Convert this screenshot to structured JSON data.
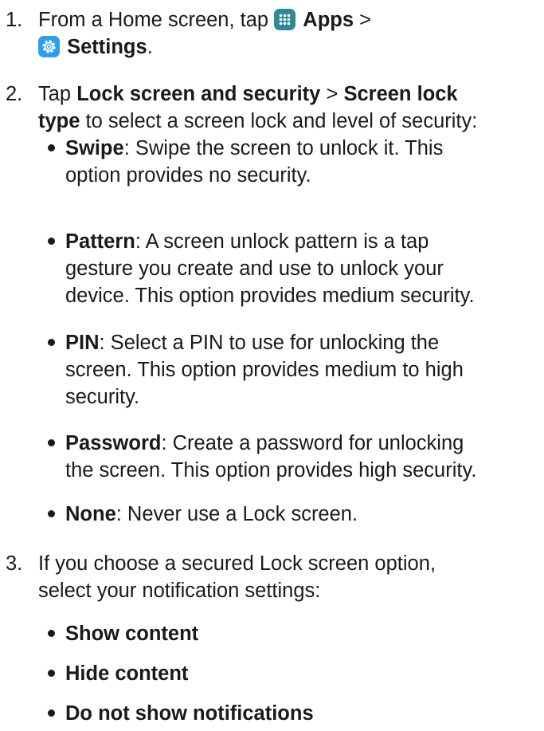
{
  "step1": {
    "number": "1.",
    "text_a": "From a Home screen, tap",
    "apps": "Apps",
    "sep": ">",
    "settings": "Settings",
    "period": ".",
    "apps_icon": "apps-grid-icon",
    "settings_icon": "gear-icon",
    "colors": {
      "apps_icon_bg": "#2d8a96",
      "settings_icon_bg": "#2f9ee6"
    }
  },
  "step2": {
    "number": "2.",
    "tap": "Tap",
    "lock_screen": "Lock screen and security",
    "sep": ">",
    "screen_lock": "Screen lock",
    "type": "type",
    "rest": "to select a screen lock and level of security:",
    "options": [
      {
        "name": "Swipe",
        "desc_1": ": Swipe the screen to unlock it. This",
        "desc_2": "option provides no security."
      },
      {
        "name": "Pattern",
        "desc_1": ": A screen unlock pattern is a tap",
        "desc_2": "gesture you create and use to unlock your",
        "desc_3": "device. This option provides medium security."
      },
      {
        "name": "PIN",
        "desc_1": ": Select a PIN to use for unlocking the",
        "desc_2": "screen. This option provides medium to high",
        "desc_3": "security."
      },
      {
        "name": "Password",
        "desc_1": ": Create a password for unlocking",
        "desc_2": "the screen. This option provides high security."
      },
      {
        "name": "None",
        "desc_1": ": Never use a Lock screen."
      }
    ]
  },
  "step3": {
    "number": "3.",
    "line_1": "If you choose a secured Lock screen option,",
    "line_2": "select your notification settings:",
    "options": [
      "Show content",
      "Hide content",
      "Do not show notifications"
    ]
  }
}
